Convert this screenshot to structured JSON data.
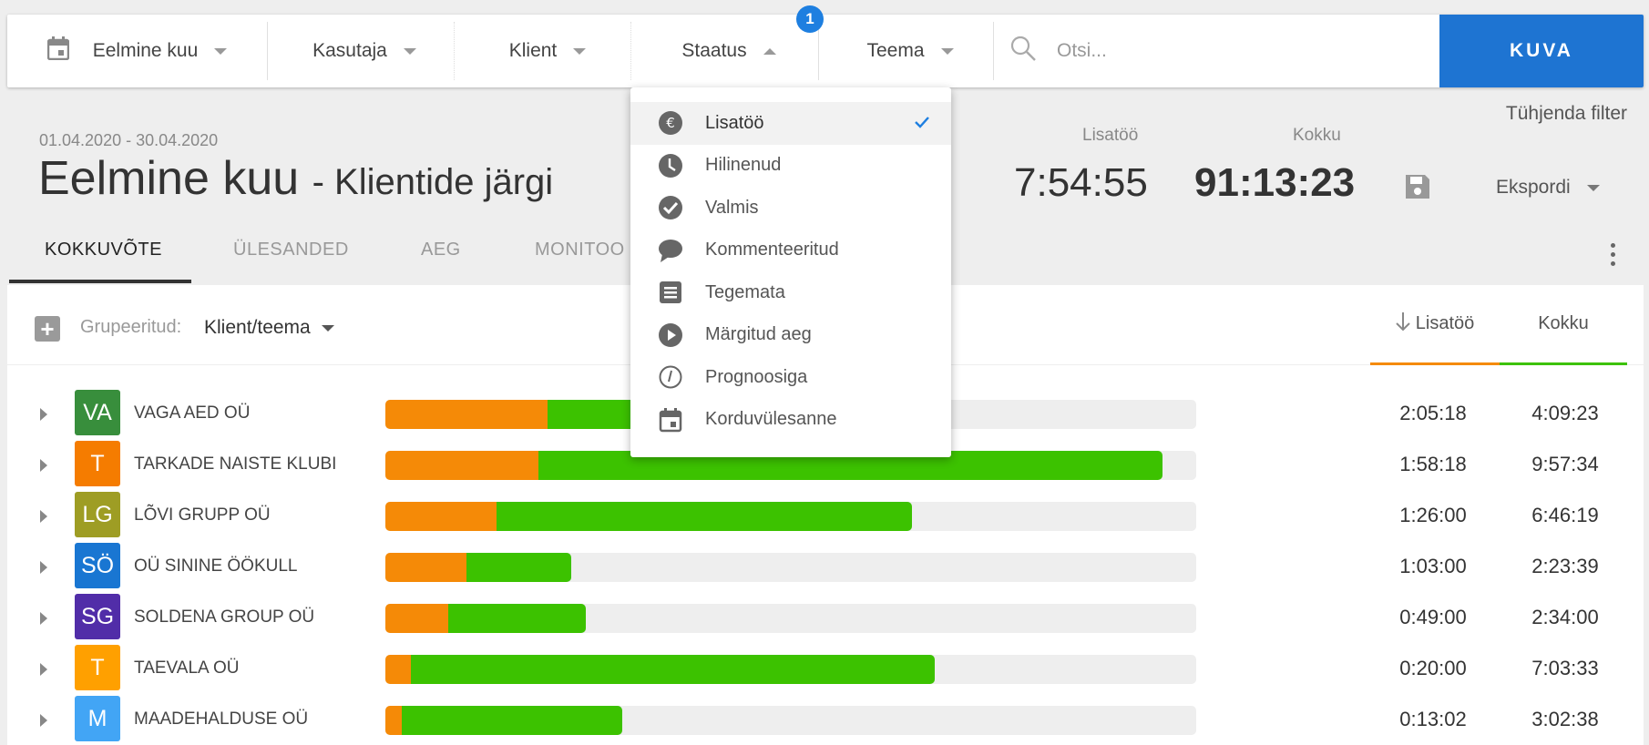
{
  "filters": {
    "period": "Eelmine kuu",
    "user": "Kasutaja",
    "client": "Klient",
    "status": "Staatus",
    "status_badge": "1",
    "topic": "Teema",
    "search_placeholder": "Otsi...",
    "show_button": "KUVA"
  },
  "header": {
    "clear_filter": "Tühjenda filter",
    "date_range": "01.04.2020 - 30.04.2020",
    "title": "Eelmine kuu",
    "subtitle": "- Klientide järgi",
    "stats": [
      {
        "label": "Lisatöö",
        "value": "7:54:55"
      },
      {
        "label": "Kokku",
        "value": "91:13:23"
      }
    ],
    "export_label": "Ekspordi"
  },
  "tabs": [
    {
      "label": "KOKKUVÕTE",
      "active": true
    },
    {
      "label": "ÜLESANDED",
      "active": false
    },
    {
      "label": "AEG",
      "active": false
    },
    {
      "label": "MONITOO",
      "active": false
    }
  ],
  "table": {
    "group_label": "Grupeeritud:",
    "group_value": "Klient/teema",
    "col_extra": "Lisatöö",
    "col_total": "Kokku",
    "colors": {
      "extra": "#f58a07",
      "total": "#3cc200"
    },
    "rows": [
      {
        "initials": "VA",
        "name": "VAGA AED OÜ",
        "color": "#388e3c",
        "extra_frac": 0.2,
        "total_frac": 0.55,
        "extra": "2:05:18",
        "total": "4:09:23"
      },
      {
        "initials": "T",
        "name": "TARKADE NAISTE KLUBI",
        "color": "#f57c00",
        "extra_frac": 0.189,
        "total_frac": 0.958,
        "extra": "1:58:18",
        "total": "9:57:34"
      },
      {
        "initials": "LG",
        "name": "LÕVI GRUPP OÜ",
        "color": "#9e9d24",
        "extra_frac": 0.137,
        "total_frac": 0.649,
        "extra": "1:26:00",
        "total": "6:46:19"
      },
      {
        "initials": "SÖ",
        "name": "OÜ SININE ÖÖKULL",
        "color": "#1976d2",
        "extra_frac": 0.1,
        "total_frac": 0.229,
        "extra": "1:03:00",
        "total": "2:23:39"
      },
      {
        "initials": "SG",
        "name": "SOLDENA GROUP OÜ",
        "color": "#512da8",
        "extra_frac": 0.078,
        "total_frac": 0.247,
        "extra": "0:49:00",
        "total": "2:34:00"
      },
      {
        "initials": "T",
        "name": "TAEVALA OÜ",
        "color": "#ffa000",
        "extra_frac": 0.031,
        "total_frac": 0.678,
        "extra": "0:20:00",
        "total": "7:03:33"
      },
      {
        "initials": "M",
        "name": "MAADEHALDUSE OÜ",
        "color": "#42a5f5",
        "extra_frac": 0.02,
        "total_frac": 0.292,
        "extra": "0:13:02",
        "total": "3:02:38"
      }
    ]
  },
  "status_menu": {
    "items": [
      {
        "label": "Lisatöö",
        "icon": "euro-icon",
        "selected": true
      },
      {
        "label": "Hilinenud",
        "icon": "clock-icon",
        "selected": false
      },
      {
        "label": "Valmis",
        "icon": "check-circle-icon",
        "selected": false
      },
      {
        "label": "Kommenteeritud",
        "icon": "comment-icon",
        "selected": false
      },
      {
        "label": "Tegemata",
        "icon": "list-icon",
        "selected": false
      },
      {
        "label": "Märgitud aeg",
        "icon": "play-circle-icon",
        "selected": false
      },
      {
        "label": "Prognoosiga",
        "icon": "forecast-icon",
        "selected": false
      },
      {
        "label": "Korduvülesanne",
        "icon": "calendar-icon",
        "selected": false
      }
    ],
    "check_color": "#1e7fe0"
  }
}
